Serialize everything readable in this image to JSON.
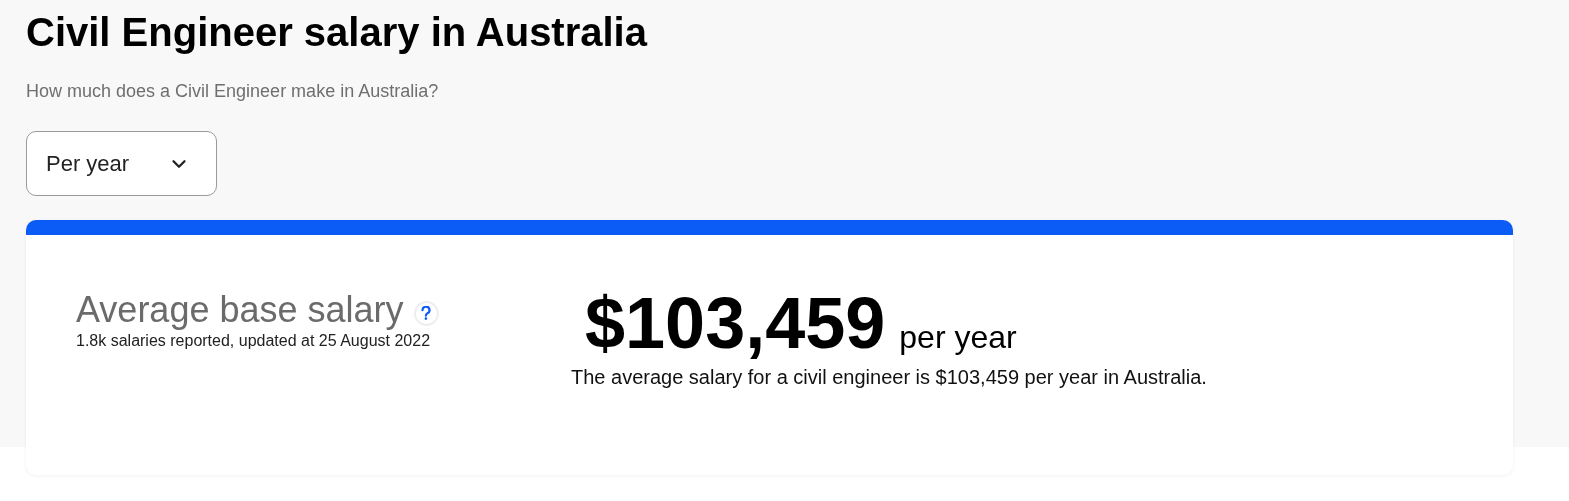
{
  "title": "Civil Engineer salary in Australia",
  "subtitle": "How much does a Civil Engineer make in Australia?",
  "period_select": {
    "value": "Per year"
  },
  "salary_card": {
    "label": "Average base salary",
    "meta": "1.8k salaries reported, updated at 25 August 2022",
    "amount": "$103,459",
    "unit": "per year",
    "summary": "The average salary for a civil engineer is $103,459 per year in Australia."
  }
}
